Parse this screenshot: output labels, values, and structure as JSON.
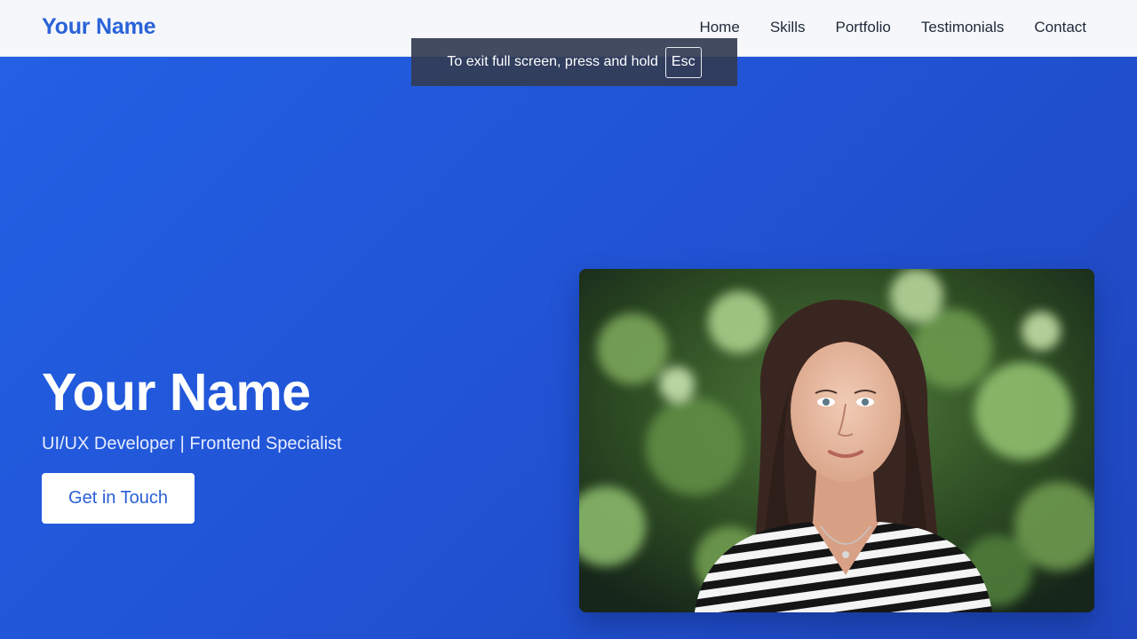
{
  "nav": {
    "brand": "Your Name",
    "links": [
      "Home",
      "Skills",
      "Portfolio",
      "Testimonials",
      "Contact"
    ]
  },
  "hero": {
    "title": "Your Name",
    "subtitle": "UI/UX Developer | Frontend Specialist",
    "cta_label": "Get in Touch"
  },
  "fullscreen_toast": {
    "text": "To exit full screen, press and hold",
    "key": "Esc"
  },
  "colors": {
    "brand": "#2a62d8",
    "hero_bg": "#2158dc",
    "nav_bg": "#f5f7fb",
    "cta_text": "#2a5fd6"
  }
}
